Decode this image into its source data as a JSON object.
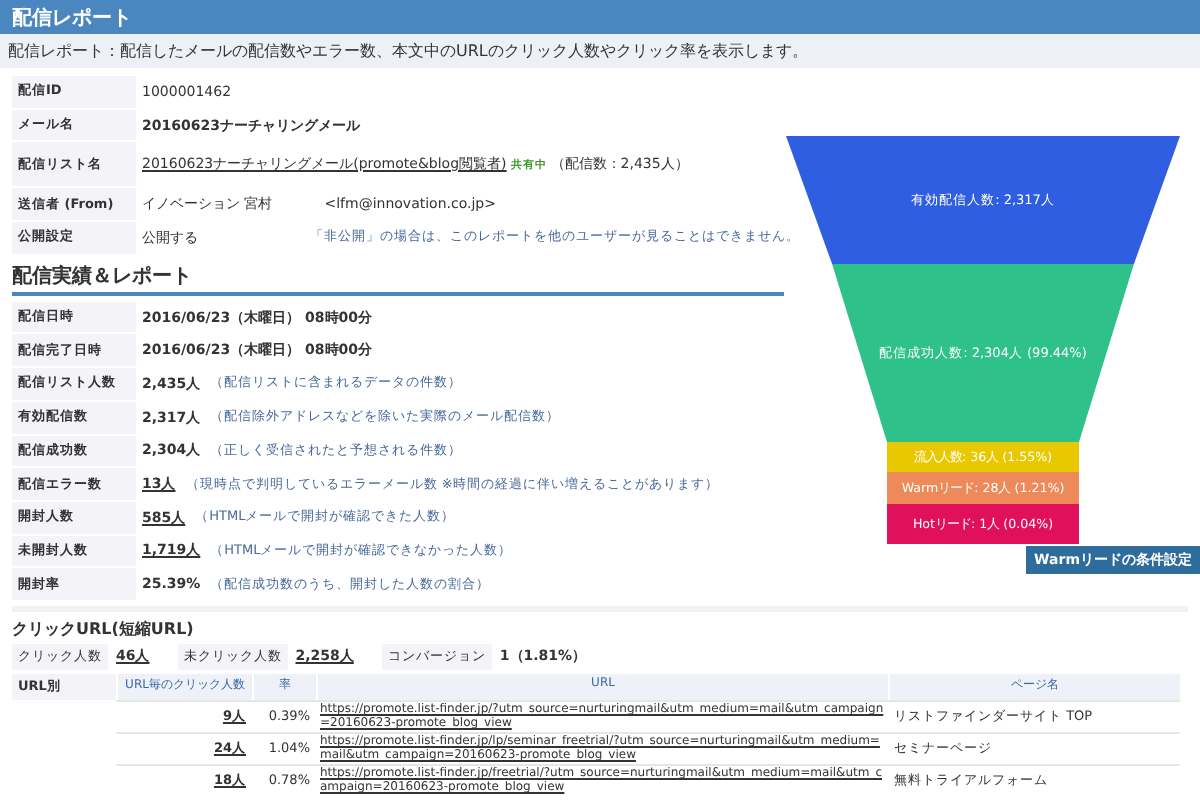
{
  "header": {
    "title": "配信レポート"
  },
  "description": "配信レポート：配信したメールの配信数やエラー数、本文中のURLのクリック人数やクリック率を表示します。",
  "info": [
    {
      "label": "配信ID",
      "kind": "plain",
      "value": "1000001462"
    },
    {
      "label": "メール名",
      "kind": "bold",
      "value": "20160623ナーチャリングメール"
    },
    {
      "label": "配信リスト名",
      "kind": "list",
      "value": "20160623ナーチャリングメール(promote&blog閲覧者)",
      "badge": "共有中",
      "note": "（配信数：2,435人）"
    },
    {
      "label": "送信者 (From)",
      "kind": "sender",
      "value": "イノベーション 宮村",
      "email": "<lfm@innovation.co.jp>"
    },
    {
      "label": "公開設定",
      "kind": "setting",
      "value": "公開する",
      "note": "「非公開」の場合は、このレポートを他のユーザーが見ることはできません。"
    }
  ],
  "results": {
    "title": "配信実績＆レポート",
    "rows": [
      {
        "label": "配信日時",
        "value": "2016/06/23（木曜日） 08時00分",
        "linked": false
      },
      {
        "label": "配信完了日時",
        "value": "2016/06/23（木曜日） 08時00分",
        "linked": false
      },
      {
        "label": "配信リスト人数",
        "value": "2,435人",
        "linked": false,
        "note": "（配信リストに含まれるデータの件数）"
      },
      {
        "label": "有効配信数",
        "value": "2,317人",
        "linked": false,
        "note": "（配信除外アドレスなどを除いた実際のメール配信数）"
      },
      {
        "label": "配信成功数",
        "value": "2,304人",
        "linked": false,
        "note": "（正しく受信されたと予想される件数）"
      },
      {
        "label": "配信エラー数",
        "value": "13人",
        "linked": true,
        "note": "（現時点で判明しているエラーメール数 ※時間の経過に伴い増えることがあります）"
      },
      {
        "label": "開封人数",
        "value": "585人",
        "linked": true,
        "note": "（HTMLメールで開封が確認できた人数）"
      },
      {
        "label": "未開封人数",
        "value": "1,719人",
        "linked": true,
        "note": "（HTMLメールで開封が確認できなかった人数）"
      },
      {
        "label": "開封率",
        "value": "25.39%",
        "linked": false,
        "note": "（配信成功数のうち、開封した人数の割合）"
      }
    ]
  },
  "funnel": {
    "stages": [
      {
        "label": "有効配信人数: 2,317人",
        "color": "#2f5fe0"
      },
      {
        "label": "配信成功人数: 2,304人 (99.44%)",
        "color": "#2ec28a"
      },
      {
        "label": "流入人数: 36人 (1.55%)",
        "color": "#e8c800"
      },
      {
        "label": "Warmリード: 28人 (1.21%)",
        "color": "#ee8a5a"
      },
      {
        "label": "Hotリード: 1人 (0.04%)",
        "color": "#e0105a"
      }
    ],
    "button": "Warmリードの条件設定"
  },
  "clicks": {
    "title": "クリックURL(短縮URL)",
    "stats": [
      {
        "label": "クリック人数",
        "value": "46人",
        "linked": true
      },
      {
        "label": "未クリック人数",
        "value": "2,258人",
        "linked": true
      },
      {
        "label": "コンバージョン",
        "value": "1（1.81%）",
        "linked": false
      }
    ],
    "table_label": "URL別",
    "columns": [
      "URL毎のクリック人数",
      "率",
      "URL",
      "ページ名"
    ],
    "rows": [
      {
        "count": "9人",
        "rate": "0.39%",
        "url": "https://promote.list-finder.jp/?utm_source=nurturingmail&utm_medium=mail&utm_campaign=20160623-promote_blog_view",
        "page": "リストファインダーサイト TOP"
      },
      {
        "count": "24人",
        "rate": "1.04%",
        "url": "https://promote.list-finder.jp/lp/seminar_freetrial/?utm_source=nurturingmail&utm_medium=mail&utm_campaign=20160623-promote_blog_view",
        "page": "セミナーページ"
      },
      {
        "count": "18人",
        "rate": "0.78%",
        "url": "https://promote.list-finder.jp/freetrial/?utm_source=nurturingmail&utm_medium=mail&utm_campaign=20160623-promote_blog_view",
        "page": "無料トライアルフォーム"
      }
    ]
  }
}
